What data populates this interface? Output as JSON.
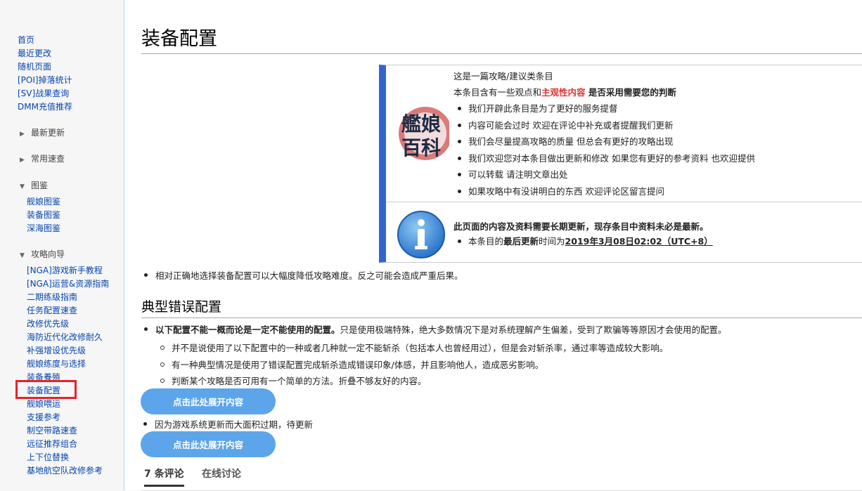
{
  "sidebar": {
    "top_links": [
      "首页",
      "最近更改",
      "随机页面",
      "[POI]掉落统计",
      "[SV]战果查询",
      "DMM充值推荐"
    ],
    "sections": {
      "latest": "最新更新",
      "quick": "常用速查",
      "atlas": "图鉴",
      "guide": "攻略向导"
    },
    "atlas_links": [
      "舰娘图鉴",
      "装备图鉴",
      "深海图鉴"
    ],
    "guide_links": [
      "[NGA]游戏新手教程",
      "[NGA]运营&资源指南",
      "二期练级指南",
      "任务配置速查",
      "改修优先级",
      "海防近代化改修耐久",
      "补强增设优先级",
      "舰娘练度与选择",
      "装备養殖",
      "装备配置",
      "舰娘喂运",
      "支援参考",
      "制空带路速查",
      "远征推荐组合",
      "上下位替换",
      "基地航空队改修参考"
    ],
    "collapsed_icon": "triangle-right-icon",
    "expanded_icon": "triangle-down-icon",
    "highlight_color": "#e8212a"
  },
  "page": {
    "title": "装备配置"
  },
  "notice": {
    "line1": "这是一篇攻略/建议类条目",
    "line2_pre": "本条目含有一些观点和",
    "line2_red": "主观性内容",
    "line2_post": " 是否采用需要您的判断",
    "items": [
      "我们开辟此条目是为了更好的服务提督",
      "内容可能会过时 欢迎在评论中补充或者提醒我们更新",
      "我们会尽量提高攻略的质量 但总会有更好的攻略出现",
      "我们欢迎您对本条目做出更新和修改 如果您有更好的参考资料 也欢迎提供",
      "可以转载 请注明文章出处",
      "如果攻略中有没讲明白的东西 欢迎评论区留言提问"
    ],
    "logo_text_1": "艦娘",
    "logo_text_2": "百科",
    "update_bold": "此页面的内容及资料需要长期更新，现存条目中资料未必是最新。",
    "update_pre": "本条目的",
    "update_bold2": "最后更新",
    "update_mid": "时间为",
    "update_time": "2019年3月08日02:02（UTC+8）",
    "accent": "#3366cc"
  },
  "body": {
    "intro": "相对正确地选择装备配置可以大幅度降低攻略难度。反之可能会造成严重后果。",
    "section_title": "典型错误配置",
    "warn_bold": "以下配置不能一概而论是一定不能使用的配置。",
    "warn_rest": "只是使用极端特殊，绝大多数情况下是对系统理解产生偏差，受到了欺骗等等原因才会使用的配置。",
    "sub_items": [
      "并不是说使用了以下配置中的一种或者几种就一定不能斩杀（包括本人也曾经用过），但是会对斩杀率，通过率等造成较大影响。",
      "有一种典型情况是使用了错误配置完成斩杀造成错误印象/体感，并且影响他人，造成恶劣影响。",
      "判断某个攻略是否可用有一个简单的方法。折叠不够友好的内容。"
    ],
    "expand_label": "点击此处展开内容",
    "outdated": "因为游戏系统更新而大面积过期，待更新",
    "button_color": "#5da5ea"
  },
  "tabs": {
    "comments": "7 条评论",
    "online": "在线讨论"
  }
}
